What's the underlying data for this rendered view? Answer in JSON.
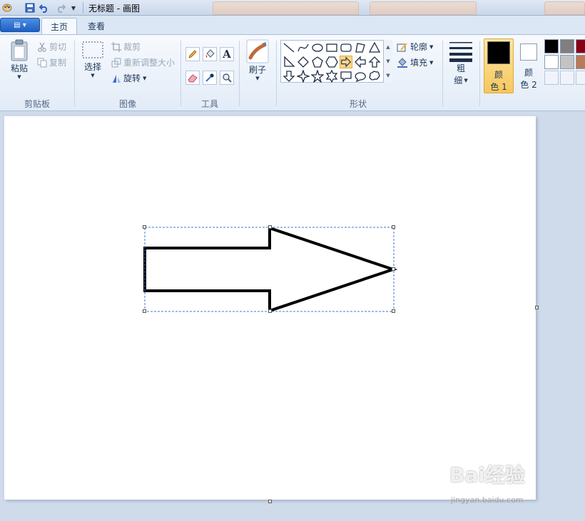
{
  "window": {
    "title": "无标题 - 画图"
  },
  "menu": {
    "tabs": [
      {
        "label": "主页",
        "active": true
      },
      {
        "label": "查看",
        "active": false
      }
    ]
  },
  "ribbon": {
    "clipboard": {
      "group_label": "剪贴板",
      "paste": "粘贴",
      "cut": "剪切",
      "copy": "复制"
    },
    "image": {
      "group_label": "图像",
      "select": "选择",
      "crop": "裁剪",
      "resize": "重新调整大小",
      "rotate": "旋转"
    },
    "tools": {
      "group_label": "工具",
      "text_glyph": "A"
    },
    "brushes": {
      "label": "刷子"
    },
    "shapes": {
      "group_label": "形状",
      "outline": "轮廓",
      "fill": "填充",
      "selected_shape": "right-arrow"
    },
    "size": {
      "label_line1": "粗",
      "label_line2": "细"
    },
    "colors": {
      "color1_line1": "颜",
      "color1_line2": "色 1",
      "color2_line1": "颜",
      "color2_line2": "色 2",
      "color1_value": "#000000",
      "color2_value": "#ffffff",
      "palette_row1": [
        "#000000",
        "#7f7f7f",
        "#880015"
      ],
      "palette_row2": [
        "#ffffff",
        "#c3c3c3",
        "#b97a57"
      ]
    }
  },
  "canvas": {
    "shape": "right-arrow",
    "stroke_color": "#000000",
    "fill_color": "#ffffff"
  },
  "watermark": {
    "brand": "Bai经验",
    "url": "jingyan.baidu.com"
  }
}
